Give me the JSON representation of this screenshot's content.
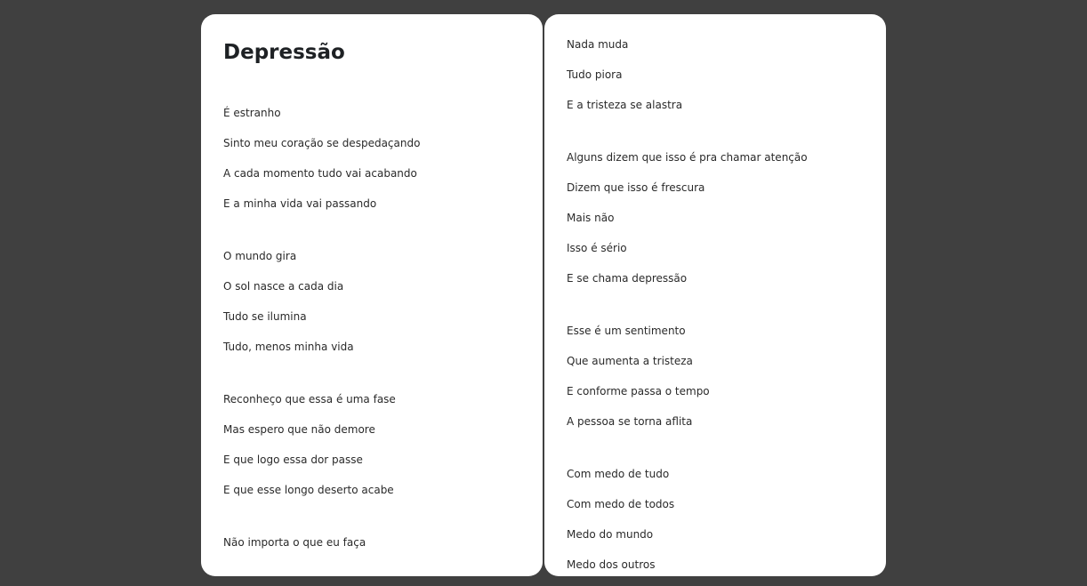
{
  "poem": {
    "title": "Depressão",
    "left_stanzas": [
      [
        "É estranho",
        "Sinto meu coração se despedaçando",
        "A cada momento tudo vai acabando",
        "E a minha vida vai passando"
      ],
      [
        "O mundo gira",
        "O sol nasce a cada dia",
        "Tudo se ilumina",
        "Tudo, menos minha vida"
      ],
      [
        "Reconheço que essa é uma fase",
        "Mas espero que não demore",
        "E que logo essa dor passe",
        "E que esse longo deserto acabe"
      ],
      [
        "Não importa o que eu faça"
      ]
    ],
    "right_stanzas": [
      [
        "Nada muda",
        "Tudo piora",
        "E a tristeza se alastra"
      ],
      [
        "Alguns dizem que isso é pra chamar atenção",
        "Dizem que isso é frescura",
        "Mais não",
        "Isso é sério",
        "E se chama depressão"
      ],
      [
        "Esse é um sentimento",
        "Que aumenta a tristeza",
        "E conforme passa o tempo",
        "A pessoa se torna aflita"
      ],
      [
        "Com medo de tudo",
        "Com medo de todos",
        "Medo do mundo",
        "Medo dos outros"
      ]
    ]
  }
}
